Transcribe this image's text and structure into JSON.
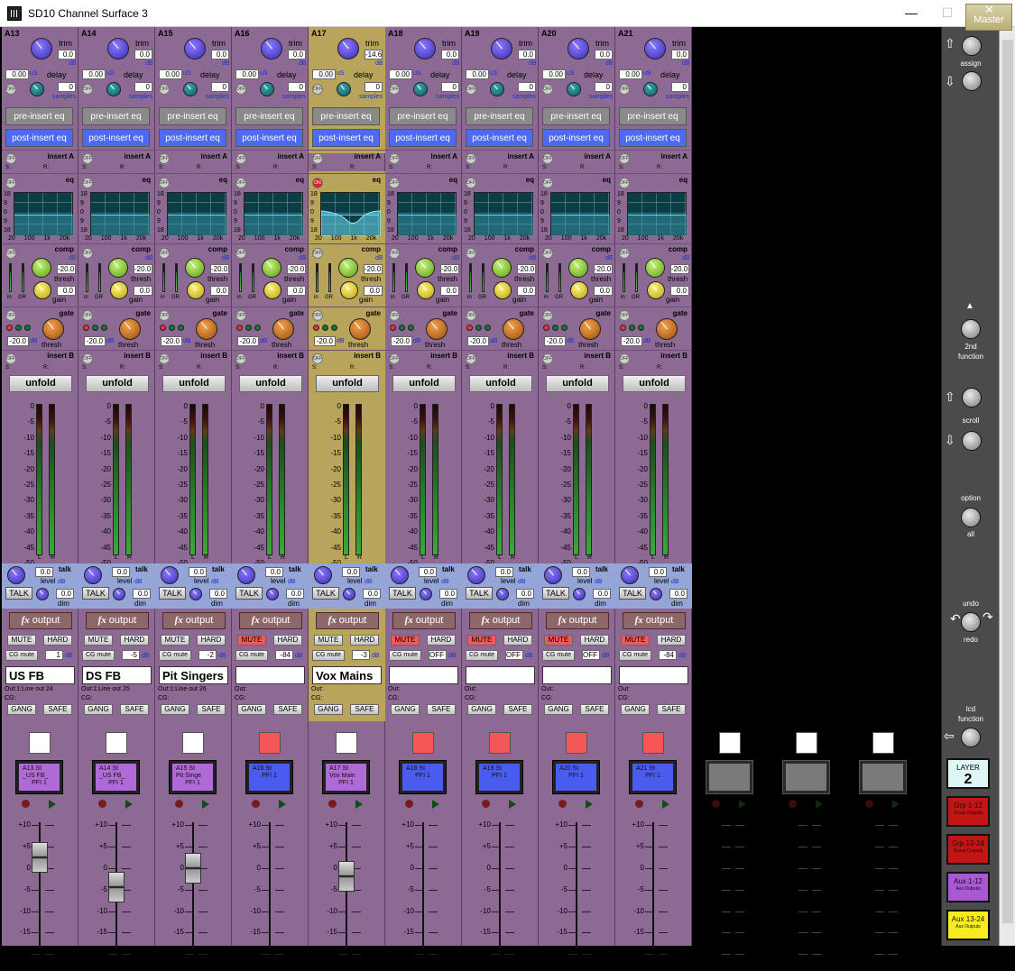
{
  "window": {
    "title": "SD10 Channel Surface 3",
    "master_label": "Master",
    "minimize": "—",
    "maximize": "☐",
    "close": "✕"
  },
  "labels": {
    "trim": "trim",
    "delay": "delay",
    "dB": "dB",
    "uS": "uS",
    "samples": "samples",
    "off": "OFF",
    "on": "ON",
    "pre_eq": "pre-insert eq",
    "post_eq": "post-insert eq",
    "insertA": "insert A",
    "insertB": "insert B",
    "eq": "eq",
    "comp": "comp",
    "gate": "gate",
    "thresh": "thresh",
    "gain": "gain",
    "in": "in",
    "gr": "GR",
    "unfold": "unfold",
    "talk": "talk",
    "level": "level",
    "dim": "dim",
    "TALK": "TALK",
    "fx": "fx",
    "output": "output",
    "mute": "MUTE",
    "hard": "HARD",
    "cgmute": "CG mute",
    "gang": "GANG",
    "safe": "SAFE",
    "s": "S:",
    "r": "R:",
    "out": "Out:",
    "cg": "CG:",
    "L": "L",
    "R": "R"
  },
  "eq_scale": [
    "18",
    "9",
    "0",
    "9",
    "18"
  ],
  "eq_freq": [
    "20",
    "100",
    "1k",
    "20k"
  ],
  "comp_scale": [
    "3",
    "6",
    "12",
    "20",
    "30",
    "40",
    "60"
  ],
  "comp_scale2": [
    "3",
    "6",
    "12",
    "24"
  ],
  "meter_scale": [
    "0",
    "-5",
    "-10",
    "-15",
    "-20",
    "-25",
    "-30",
    "-35",
    "-40",
    "-45",
    "-50",
    "-60"
  ],
  "fader_scale": [
    "+10",
    "+5",
    "0",
    "-5",
    "-10",
    "-15",
    "-20"
  ],
  "channels": [
    {
      "id": "A13",
      "trim": "0.0",
      "delay_us": "0.00",
      "delay_samples": "0",
      "comp_thresh": "-20.0",
      "comp_gain": "0.0",
      "gate_thresh": "-20.0",
      "talk_level": "0.0",
      "dim": "0.0",
      "cg_value": "1",
      "name": "US FB",
      "out": "Out:1:Line out 24",
      "lcd": [
        "A13 St",
        "_US FB_",
        "PFI 1"
      ],
      "lcd_color": "purple",
      "sel_color": "white",
      "mute_on": false,
      "eq_on": false,
      "selected": false,
      "fader_pos": 0.17
    },
    {
      "id": "A14",
      "trim": "0.0",
      "delay_us": "0.00",
      "delay_samples": "0",
      "comp_thresh": "-20.0",
      "comp_gain": "0.0",
      "gate_thresh": "-20.0",
      "talk_level": "0.0",
      "dim": "0.0",
      "cg_value": "-5",
      "name": "DS FB",
      "out": "Out:1:Line out 25",
      "lcd": [
        "A14 St",
        "_US FB_",
        "PFI 1"
      ],
      "lcd_color": "purple",
      "sel_color": "white",
      "mute_on": false,
      "eq_on": false,
      "selected": false,
      "fader_pos": 0.41
    },
    {
      "id": "A15",
      "trim": "0.0",
      "delay_us": "0.00",
      "delay_samples": "0",
      "comp_thresh": "-20.0",
      "comp_gain": "0.0",
      "gate_thresh": "-20.0",
      "talk_level": "0.0",
      "dim": "0.0",
      "cg_value": "-2",
      "name": "Pit Singers",
      "out": "Out:1:Line out 26",
      "lcd": [
        "A15 St",
        "Pit Singe",
        "PFI 1"
      ],
      "lcd_color": "purple",
      "sel_color": "white",
      "mute_on": false,
      "eq_on": false,
      "selected": false,
      "fader_pos": 0.26
    },
    {
      "id": "A16",
      "trim": "0.0",
      "delay_us": "0.00",
      "delay_samples": "0",
      "comp_thresh": "-20.0",
      "comp_gain": "0.0",
      "gate_thresh": "-20.0",
      "talk_level": "0.0",
      "dim": "0.0",
      "cg_value": "-84",
      "name": "",
      "out": "Out:",
      "lcd": [
        "A16 St",
        "",
        "PFI 1"
      ],
      "lcd_color": "blue",
      "sel_color": "red",
      "mute_on": true,
      "eq_on": false,
      "selected": false,
      "fader_pos": null
    },
    {
      "id": "A17",
      "trim": "-14.6",
      "delay_us": "0.00",
      "delay_samples": "0",
      "comp_thresh": "-20.0",
      "comp_gain": "0.0",
      "gate_thresh": "-20.0",
      "talk_level": "0.0",
      "dim": "0.0",
      "cg_value": "-3",
      "name": "Vox Mains",
      "out": "Out:",
      "lcd": [
        "A17 St",
        "Vox Main",
        "PFI 1"
      ],
      "lcd_color": "purple",
      "sel_color": "white",
      "mute_on": false,
      "eq_on": true,
      "selected": true,
      "fader_pos": 0.32
    },
    {
      "id": "A18",
      "trim": "0.0",
      "delay_us": "0.00",
      "delay_samples": "0",
      "comp_thresh": "-20.0",
      "comp_gain": "0.0",
      "gate_thresh": "-20.0",
      "talk_level": "0.0",
      "dim": "0.0",
      "cg_value": "OFF",
      "name": "",
      "out": "Out:",
      "lcd": [
        "A18 St",
        "",
        "PFI 1"
      ],
      "lcd_color": "blue",
      "sel_color": "red",
      "mute_on": true,
      "eq_on": false,
      "selected": false,
      "fader_pos": null
    },
    {
      "id": "A19",
      "trim": "0.0",
      "delay_us": "0.00",
      "delay_samples": "0",
      "comp_thresh": "-20.0",
      "comp_gain": "0.0",
      "gate_thresh": "-20.0",
      "talk_level": "0.0",
      "dim": "0.0",
      "cg_value": "OFF",
      "name": "",
      "out": "Out:",
      "lcd": [
        "A19 St",
        "",
        "PFI 1"
      ],
      "lcd_color": "blue",
      "sel_color": "red",
      "mute_on": true,
      "eq_on": false,
      "selected": false,
      "fader_pos": null
    },
    {
      "id": "A20",
      "trim": "0.0",
      "delay_us": "0.00",
      "delay_samples": "0",
      "comp_thresh": "-20.0",
      "comp_gain": "0.0",
      "gate_thresh": "-20.0",
      "talk_level": "0.0",
      "dim": "0.0",
      "cg_value": "OFF",
      "name": "",
      "out": "Out:",
      "lcd": [
        "A20 St",
        "",
        "PFI 1"
      ],
      "lcd_color": "blue",
      "sel_color": "red",
      "mute_on": true,
      "eq_on": false,
      "selected": false,
      "fader_pos": null
    },
    {
      "id": "A21",
      "trim": "0.0",
      "delay_us": "0.00",
      "delay_samples": "0",
      "comp_thresh": "-20.0",
      "comp_gain": "0.0",
      "gate_thresh": "-20.0",
      "talk_level": "0.0",
      "dim": "0.0",
      "cg_value": "-84",
      "name": "",
      "out": "Out:",
      "lcd": [
        "A21 St",
        "",
        "PFI 1"
      ],
      "lcd_color": "blue",
      "sel_color": "red",
      "mute_on": true,
      "eq_on": false,
      "selected": false,
      "fader_pos": null
    }
  ],
  "empty_channels": 3,
  "right_panel": {
    "assign": "assign",
    "second": "2nd",
    "function": "function",
    "scroll": "scroll",
    "option": "option",
    "all": "all",
    "undo": "undo",
    "redo": "redo",
    "lcd": "lcd",
    "lcd_function": "function",
    "layer_buttons": [
      {
        "top": "LAYER",
        "big": "2",
        "sub": "",
        "style": "layer2"
      },
      {
        "top": "Grp 1-12",
        "big": "",
        "sub": "Group Outputs",
        "style": "lred"
      },
      {
        "top": "Grp 13-24",
        "big": "",
        "sub": "Group Outputs",
        "style": "lred"
      },
      {
        "top": "Aux 1-12",
        "big": "",
        "sub": "Aux Outputs",
        "style": "lpurp"
      },
      {
        "top": "Aux 13-24",
        "big": "",
        "sub": "Aux Outputs",
        "style": "lyel"
      }
    ]
  }
}
